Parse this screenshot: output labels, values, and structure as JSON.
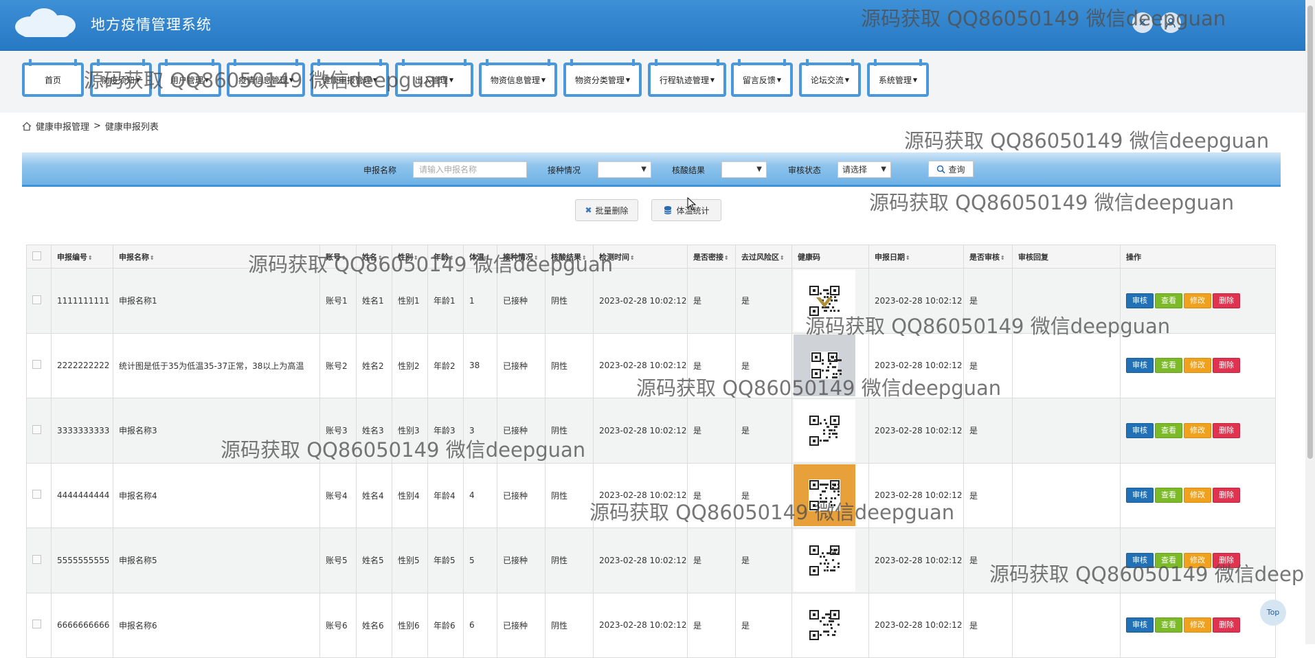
{
  "header": {
    "title": "地方疫情管理系统"
  },
  "nav": [
    {
      "label": "首页",
      "dropdown": false
    },
    {
      "label": "防疫须知",
      "dropdown": true
    },
    {
      "label": "用户管理",
      "dropdown": true
    },
    {
      "label": "疫情信息管理",
      "dropdown": true
    },
    {
      "label": "健康申报管理",
      "dropdown": true
    },
    {
      "label": "出入管理",
      "dropdown": true
    },
    {
      "label": "物资信息管理",
      "dropdown": true
    },
    {
      "label": "物资分类管理",
      "dropdown": true
    },
    {
      "label": "行程轨迹管理",
      "dropdown": true
    },
    {
      "label": "留言反馈",
      "dropdown": true
    },
    {
      "label": "论坛交流",
      "dropdown": true
    },
    {
      "label": "系统管理",
      "dropdown": true
    }
  ],
  "breadcrumb": {
    "parent": "健康申报管理",
    "separator": ">",
    "current": "健康申报列表"
  },
  "search": {
    "name_label": "申报名称",
    "name_placeholder": "请输入申报名称",
    "vaccine_label": "接种情况",
    "vaccine_value": "",
    "nucleic_label": "核酸结果",
    "nucleic_value": "",
    "audit_label": "审核状态",
    "audit_value": "请选择",
    "query_label": "查询"
  },
  "actions": {
    "batch_delete": "批量删除",
    "temp_stats": "体温统计"
  },
  "table": {
    "headers": [
      "申报编号",
      "申报名称",
      "账号",
      "姓名",
      "性别",
      "年龄",
      "体温",
      "接种情况",
      "核酸结果",
      "检测时间",
      "是否密接",
      "去过风险区",
      "健康码",
      "申报日期",
      "是否审核",
      "审核回复",
      "操作"
    ],
    "sortable": [
      true,
      true,
      true,
      true,
      true,
      true,
      true,
      true,
      true,
      true,
      true,
      true,
      false,
      true,
      true,
      false,
      false
    ],
    "rows": [
      {
        "id": "1111111111",
        "name": "申报名称1",
        "account": "账号1",
        "realname": "姓名1",
        "gender": "性别1",
        "age": "年龄1",
        "temp": "1",
        "vaccine": "已接种",
        "nucleic": "阴性",
        "test_time": "2023-02-28 10:02:12",
        "close_contact": "是",
        "risk_area": "是",
        "date": "2023-02-28 10:02:12",
        "audited": "是",
        "reply": ""
      },
      {
        "id": "2222222222",
        "name": "统计图是低于35为低温35-37正常，38以上为高温",
        "account": "账号2",
        "realname": "姓名2",
        "gender": "性别2",
        "age": "年龄2",
        "temp": "38",
        "vaccine": "已接种",
        "nucleic": "阴性",
        "test_time": "2023-02-28 10:02:12",
        "close_contact": "是",
        "risk_area": "是",
        "date": "2023-02-28 10:02:12",
        "audited": "是",
        "reply": ""
      },
      {
        "id": "3333333333",
        "name": "申报名称3",
        "account": "账号3",
        "realname": "姓名3",
        "gender": "性别3",
        "age": "年龄3",
        "temp": "3",
        "vaccine": "已接种",
        "nucleic": "阴性",
        "test_time": "2023-02-28 10:02:12",
        "close_contact": "是",
        "risk_area": "是",
        "date": "2023-02-28 10:02:12",
        "audited": "是",
        "reply": ""
      },
      {
        "id": "4444444444",
        "name": "申报名称4",
        "account": "账号4",
        "realname": "姓名4",
        "gender": "性别4",
        "age": "年龄4",
        "temp": "4",
        "vaccine": "已接种",
        "nucleic": "阴性",
        "test_time": "2023-02-28 10:02:12",
        "close_contact": "是",
        "risk_area": "是",
        "date": "2023-02-28 10:02:12",
        "audited": "是",
        "reply": ""
      },
      {
        "id": "5555555555",
        "name": "申报名称5",
        "account": "账号5",
        "realname": "姓名5",
        "gender": "性别5",
        "age": "年龄5",
        "temp": "5",
        "vaccine": "已接种",
        "nucleic": "阴性",
        "test_time": "2023-02-28 10:02:12",
        "close_contact": "是",
        "risk_area": "是",
        "date": "2023-02-28 10:02:12",
        "audited": "是",
        "reply": ""
      },
      {
        "id": "6666666666",
        "name": "申报名称6",
        "account": "账号6",
        "realname": "姓名6",
        "gender": "性别6",
        "age": "年龄6",
        "temp": "6",
        "vaccine": "已接种",
        "nucleic": "阴性",
        "test_time": "2023-02-28 10:02:12",
        "close_contact": "是",
        "risk_area": "是",
        "date": "2023-02-28 10:02:12",
        "audited": "是",
        "reply": ""
      }
    ],
    "ops": {
      "audit": "审核",
      "view": "查看",
      "edit": "修改",
      "delete": "删除"
    }
  },
  "watermark": "源码获取 QQ86050149 微信deepguan",
  "top_button": "Top",
  "colors": {
    "header": "#2f84cc",
    "nav_border": "#4a98dc",
    "audit": "#2271b7",
    "view": "#7cba2a",
    "edit": "#f0a21e",
    "delete": "#e0334f"
  }
}
